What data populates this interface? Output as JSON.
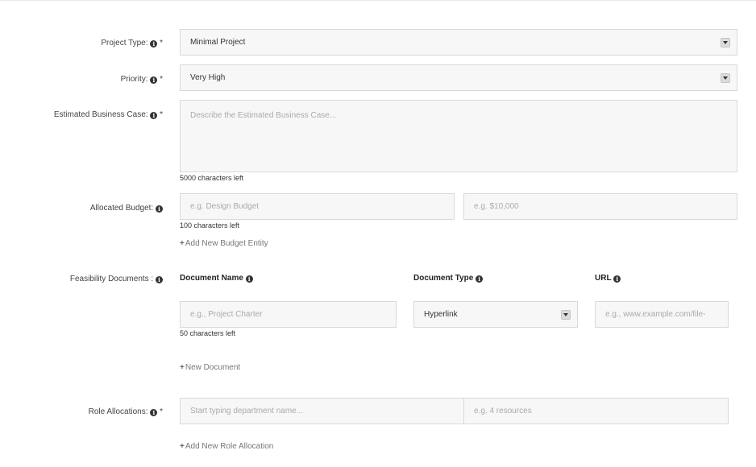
{
  "form": {
    "project_type": {
      "label": "Project Type:",
      "value": "Minimal Project",
      "required": "*"
    },
    "priority": {
      "label": "Priority:",
      "value": "Very High",
      "required": "*"
    },
    "business_case": {
      "label": "Estimated Business Case:",
      "placeholder": "Describe the Estimated Business Case...",
      "required": "*",
      "hint": "5000 characters left"
    },
    "budget": {
      "label": "Allocated Budget:",
      "name_placeholder": "e.g. Design Budget",
      "amount_placeholder": "e.g. $10,000",
      "hint": "100 characters left",
      "add_link": "Add New Budget Entity"
    },
    "feasibility": {
      "label": "Feasibility Documents :",
      "col_name": "Document Name",
      "col_type": "Document Type",
      "col_url": "URL",
      "name_placeholder": "e.g., Project Charter",
      "type_value": "Hyperlink",
      "url_placeholder": "e.g., www.example.com/file-",
      "hint": "50 characters left",
      "add_link": "New Document"
    },
    "roles": {
      "label": "Role Allocations:",
      "required": "*",
      "dept_placeholder": "Start typing department name...",
      "res_placeholder": "e.g. 4 resources",
      "add_link": "Add New Role Allocation"
    }
  },
  "icons": {
    "info": "info-circle-icon",
    "plus": "plus-icon",
    "dropdown": "dropdown-caret-icon"
  }
}
